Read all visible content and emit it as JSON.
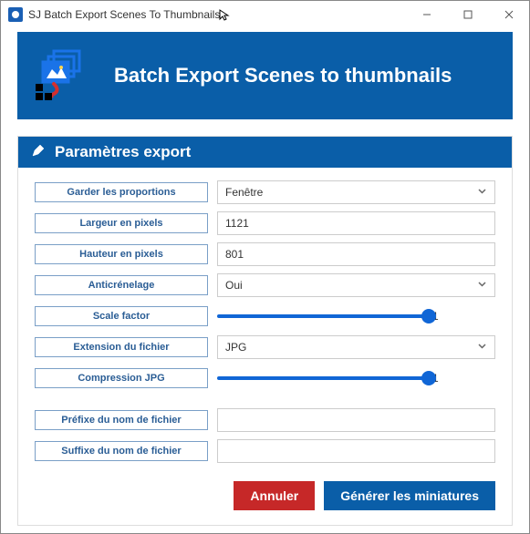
{
  "window": {
    "title": "SJ Batch Export Scenes To Thumbnails"
  },
  "banner": {
    "title": "Batch Export Scenes to thumbnails"
  },
  "section": {
    "title": "Paramètres export"
  },
  "labels": {
    "keep_ratio": "Garder les proportions",
    "width": "Largeur en pixels",
    "height": "Hauteur en pixels",
    "antialias": "Anticrénelage",
    "scale": "Scale factor",
    "extension": "Extension du fichier",
    "jpg_comp": "Compression JPG",
    "prefix": "Préfixe du nom de fichier",
    "suffix": "Suffixe du nom de fichier"
  },
  "values": {
    "keep_ratio": "Fenêtre",
    "width": "1121",
    "height": "801",
    "antialias": "Oui",
    "scale": "1",
    "extension": "JPG",
    "jpg_comp": "1",
    "prefix": "",
    "suffix": ""
  },
  "actions": {
    "cancel": "Annuler",
    "generate": "Générer les miniatures"
  }
}
